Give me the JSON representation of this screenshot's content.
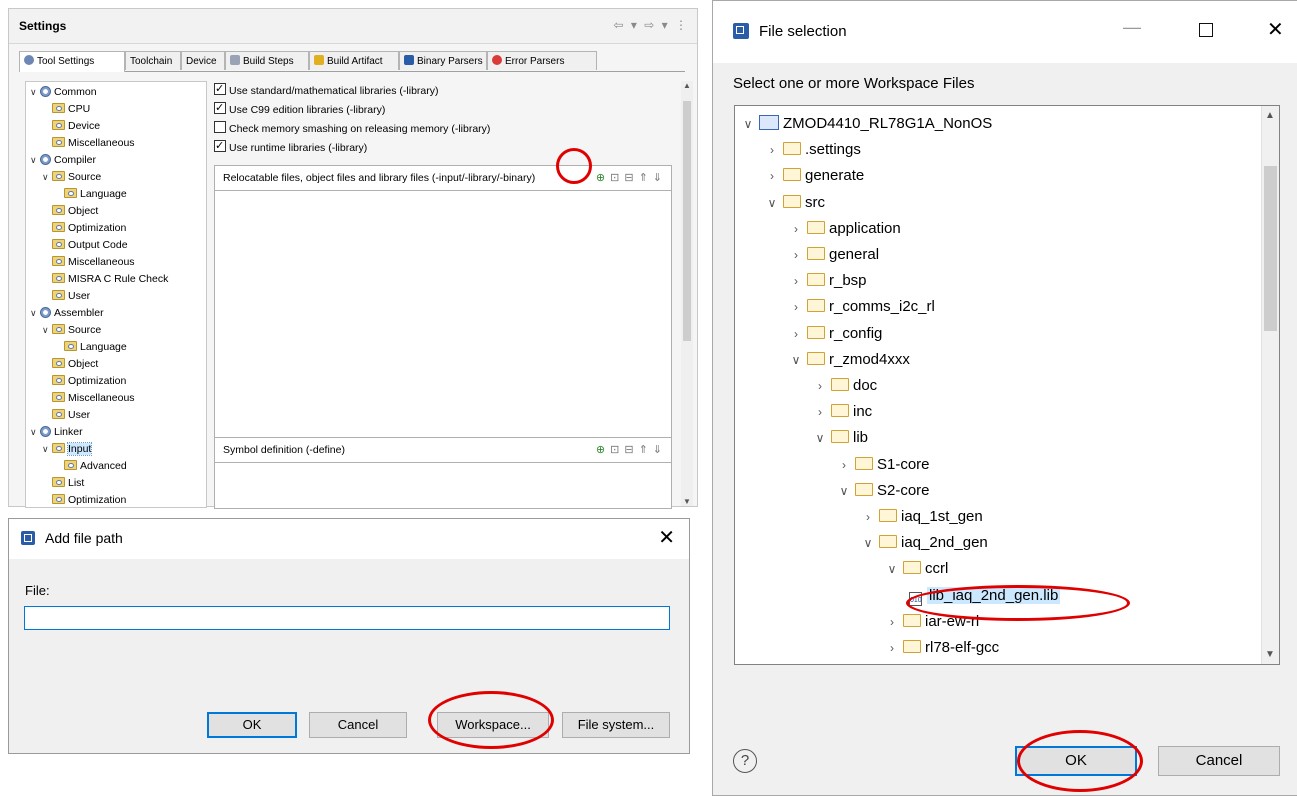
{
  "settings": {
    "title": "Settings",
    "tabs": [
      "Tool Settings",
      "Toolchain",
      "Device",
      "Build Steps",
      "Build Artifact",
      "Binary Parsers",
      "Error Parsers"
    ],
    "tree": [
      {
        "label": "Common",
        "level": 0,
        "expanded": true,
        "kind": "gear"
      },
      {
        "label": "CPU",
        "level": 1,
        "kind": "leaf"
      },
      {
        "label": "Device",
        "level": 1,
        "kind": "leaf"
      },
      {
        "label": "Miscellaneous",
        "level": 1,
        "kind": "leaf"
      },
      {
        "label": "Compiler",
        "level": 0,
        "expanded": true,
        "kind": "gear"
      },
      {
        "label": "Source",
        "level": 1,
        "expanded": true,
        "kind": "leaf"
      },
      {
        "label": "Language",
        "level": 2,
        "kind": "leaf"
      },
      {
        "label": "Object",
        "level": 1,
        "kind": "leaf"
      },
      {
        "label": "Optimization",
        "level": 1,
        "kind": "leaf"
      },
      {
        "label": "Output Code",
        "level": 1,
        "kind": "leaf"
      },
      {
        "label": "Miscellaneous",
        "level": 1,
        "kind": "leaf"
      },
      {
        "label": "MISRA C Rule Check",
        "level": 1,
        "kind": "leaf"
      },
      {
        "label": "User",
        "level": 1,
        "kind": "leaf"
      },
      {
        "label": "Assembler",
        "level": 0,
        "expanded": true,
        "kind": "gear"
      },
      {
        "label": "Source",
        "level": 1,
        "expanded": true,
        "kind": "leaf"
      },
      {
        "label": "Language",
        "level": 2,
        "kind": "leaf"
      },
      {
        "label": "Object",
        "level": 1,
        "kind": "leaf"
      },
      {
        "label": "Optimization",
        "level": 1,
        "kind": "leaf"
      },
      {
        "label": "Miscellaneous",
        "level": 1,
        "kind": "leaf"
      },
      {
        "label": "User",
        "level": 1,
        "kind": "leaf"
      },
      {
        "label": "Linker",
        "level": 0,
        "expanded": true,
        "kind": "gear"
      },
      {
        "label": "Input",
        "level": 1,
        "expanded": true,
        "kind": "leaf",
        "selected": true
      },
      {
        "label": "Advanced",
        "level": 2,
        "kind": "leaf"
      },
      {
        "label": "List",
        "level": 1,
        "kind": "leaf"
      },
      {
        "label": "Optimization",
        "level": 1,
        "kind": "leaf"
      }
    ],
    "checkboxes": [
      {
        "label": "Use standard/mathematical libraries (-library)",
        "checked": true
      },
      {
        "label": "Use C99 edition libraries (-library)",
        "checked": true
      },
      {
        "label": "Check memory smashing on releasing memory (-library)",
        "checked": false
      },
      {
        "label": "Use runtime libraries (-library)",
        "checked": true
      }
    ],
    "relocatable_label": "Relocatable files, object files and library files (-input/-library/-binary)",
    "symbol_label": "Symbol definition (-define)"
  },
  "add_path_dialog": {
    "title": "Add file path",
    "file_label": "File:",
    "file_value": "",
    "ok": "OK",
    "cancel": "Cancel",
    "workspace": "Workspace...",
    "file_system": "File system..."
  },
  "file_selection": {
    "title": "File selection",
    "prompt": "Select one or more Workspace Files",
    "tree": [
      {
        "label": "ZMOD4410_RL78G1A_NonOS",
        "level": 0,
        "expanded": true,
        "kind": "project"
      },
      {
        "label": ".settings",
        "level": 1,
        "expanded": false,
        "kind": "folder"
      },
      {
        "label": "generate",
        "level": 1,
        "expanded": false,
        "kind": "folder"
      },
      {
        "label": "src",
        "level": 1,
        "expanded": true,
        "kind": "folder"
      },
      {
        "label": "application",
        "level": 2,
        "expanded": false,
        "kind": "folder"
      },
      {
        "label": "general",
        "level": 2,
        "expanded": false,
        "kind": "folder"
      },
      {
        "label": "r_bsp",
        "level": 2,
        "expanded": false,
        "kind": "folder"
      },
      {
        "label": "r_comms_i2c_rl",
        "level": 2,
        "expanded": false,
        "kind": "folder"
      },
      {
        "label": "r_config",
        "level": 2,
        "expanded": false,
        "kind": "folder"
      },
      {
        "label": "r_zmod4xxx",
        "level": 2,
        "expanded": true,
        "kind": "folder"
      },
      {
        "label": "doc",
        "level": 3,
        "expanded": false,
        "kind": "folder"
      },
      {
        "label": "inc",
        "level": 3,
        "expanded": false,
        "kind": "folder"
      },
      {
        "label": "lib",
        "level": 3,
        "expanded": true,
        "kind": "folder"
      },
      {
        "label": "S1-core",
        "level": 4,
        "expanded": false,
        "kind": "folder"
      },
      {
        "label": "S2-core",
        "level": 4,
        "expanded": true,
        "kind": "folder"
      },
      {
        "label": "iaq_1st_gen",
        "level": 5,
        "expanded": false,
        "kind": "folder"
      },
      {
        "label": "iaq_2nd_gen",
        "level": 5,
        "expanded": true,
        "kind": "folder"
      },
      {
        "label": "ccrl",
        "level": 6,
        "expanded": true,
        "kind": "folder"
      },
      {
        "label": "lib_iaq_2nd_gen.lib",
        "level": 7,
        "kind": "libfile",
        "selected": true
      },
      {
        "label": "iar-ew-rl",
        "level": 6,
        "expanded": false,
        "kind": "folder"
      },
      {
        "label": "rl78-elf-gcc",
        "level": 6,
        "expanded": false,
        "kind": "folder"
      }
    ],
    "ok": "OK",
    "cancel": "Cancel",
    "help_glyph": "?"
  },
  "colors": {
    "highlight_ring": "#e00000",
    "accent": "#0078d7"
  }
}
